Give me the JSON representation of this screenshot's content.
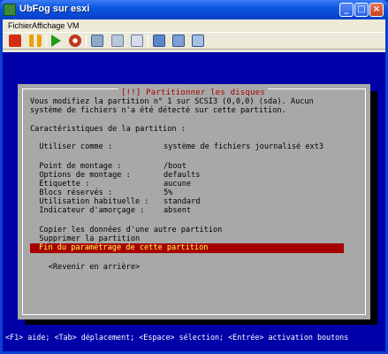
{
  "window": {
    "title": "UbFog sur esxi",
    "min_label": "_",
    "max_label": "□",
    "close_label": "×"
  },
  "menubar": {
    "items": [
      "Fichier",
      "Affichage",
      "VM"
    ]
  },
  "toolbar": {
    "icons": [
      "stop-icon",
      "pause-icon",
      "play-icon",
      "reset-icon",
      "snapshot-icon",
      "revert-snapshot-icon",
      "manage-snapshots-icon",
      "console-icon-1",
      "console-icon-2",
      "console-icon-3"
    ]
  },
  "dialog": {
    "title": "[!!] Partitionner les disques",
    "intro_line1": "Vous modifiez la partition n° 1 sur SCSI3 (0,0,0) (sda). Aucun",
    "intro_line2": "système de fichiers n'a été détecté sur cette partition.",
    "section_label": "Caractéristiques de la partition :",
    "fields": [
      {
        "label": "  Utiliser comme :",
        "value": "système de fichiers journalisé ext3"
      },
      {
        "label": "  Point de montage :",
        "value": "/boot"
      },
      {
        "label": "  Options de montage :",
        "value": "defaults"
      },
      {
        "label": "  Étiquette :",
        "value": "aucune"
      },
      {
        "label": "  Blocs réservés :",
        "value": "5%"
      },
      {
        "label": "  Utilisation habituelle :",
        "value": "standard"
      },
      {
        "label": "  Indicateur d'amorçage :",
        "value": "absent"
      }
    ],
    "actions": [
      "  Copier les données d'une autre partition",
      "  Supprimer la partition"
    ],
    "selected_action": "Fin du paramétrage de cette partition",
    "back_label": "    <Revenir en arrière>"
  },
  "help_line": "<F1> aide; <Tab> déplacement; <Espace> sélection; <Entrée> activation boutons"
}
